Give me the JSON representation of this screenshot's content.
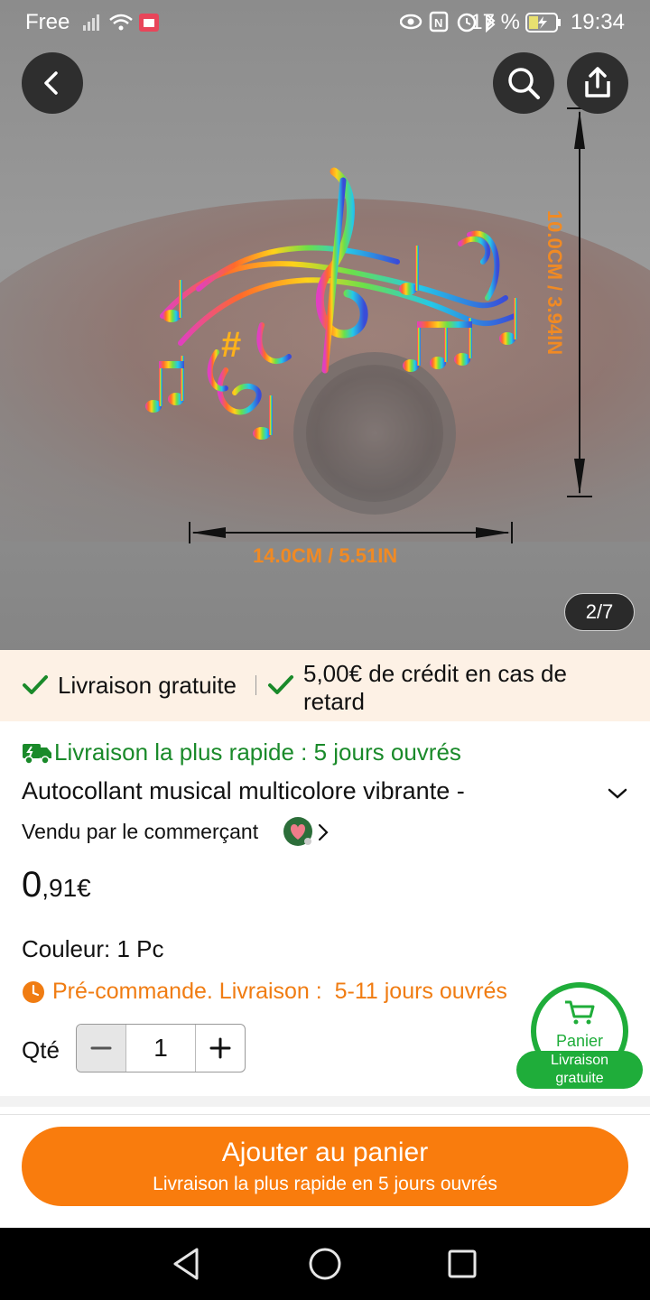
{
  "status_bar": {
    "carrier": "Free",
    "battery": "17 %",
    "time": "19:34"
  },
  "image": {
    "counter": "2/7",
    "width_label": "14.0CM / 5.51IN",
    "height_label": "10.0CM / 3.94IN"
  },
  "banner": {
    "free_shipping": "Livraison gratuite",
    "credit_line1": "5,00€ de crédit en cas de",
    "credit_line2": "retard"
  },
  "product": {
    "fast_delivery": "Livraison la plus rapide : 5 jours ouvrés",
    "title": "Autocollant musical multicolore vibrante -",
    "seller": "Vendu par le commerçant",
    "price_int": "0",
    "price_dec": ",91€",
    "color": "Couleur: 1 Pc",
    "preorder": "Pré-commande. Livraison :  5-11 jours ouvrés",
    "qty_label": "Qté",
    "qty_value": "1"
  },
  "cart_float": {
    "label": "Panier",
    "pill_line1": "Livraison",
    "pill_line2": "gratuite"
  },
  "add_button": {
    "label": "Ajouter au panier",
    "sub": "Livraison la plus rapide en 5 jours ouvrés"
  },
  "colors": {
    "accent_orange": "#f97c0d",
    "green": "#1a8a2a",
    "cart_green": "#1fad3a",
    "banner_bg": "#fdf1e5"
  }
}
